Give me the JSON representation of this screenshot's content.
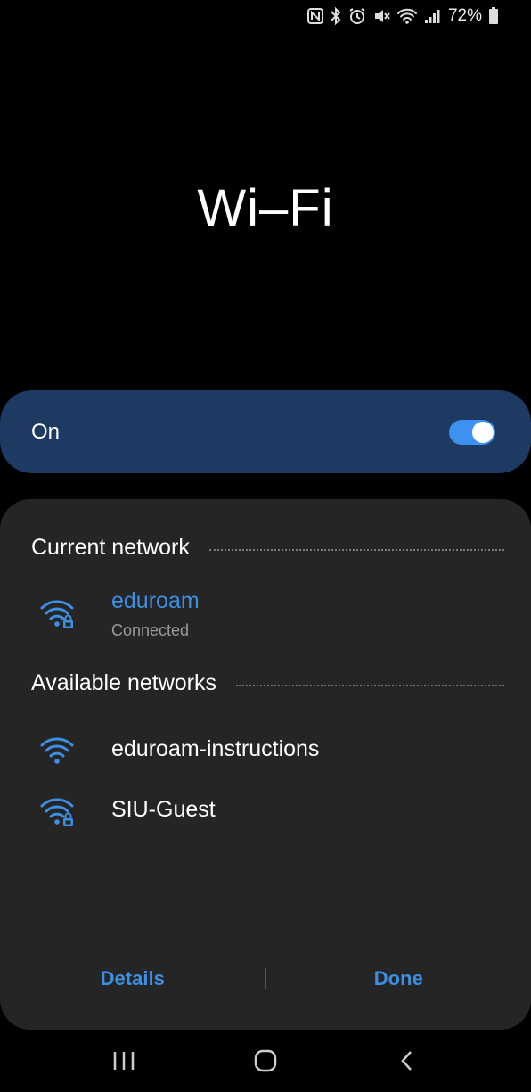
{
  "status_bar": {
    "icons": [
      "nfc-icon",
      "bluetooth-icon",
      "alarm-icon",
      "mute-icon",
      "wifi-icon",
      "signal-icon",
      "battery-icon"
    ],
    "battery": "72%"
  },
  "title": "Wi–Fi",
  "toggle": {
    "label": "On",
    "state": true
  },
  "current_network": {
    "header": "Current network",
    "name": "eduroam",
    "status": "Connected",
    "secured": true
  },
  "available_networks": {
    "header": "Available networks",
    "items": [
      {
        "name": "eduroam-instructions",
        "secured": false
      },
      {
        "name": "SIU-Guest",
        "secured": true
      }
    ]
  },
  "actions": {
    "details": "Details",
    "done": "Done"
  },
  "colors": {
    "accent": "#3d8fe4",
    "toggle_card": "#1d3a63",
    "panel": "#252525"
  }
}
